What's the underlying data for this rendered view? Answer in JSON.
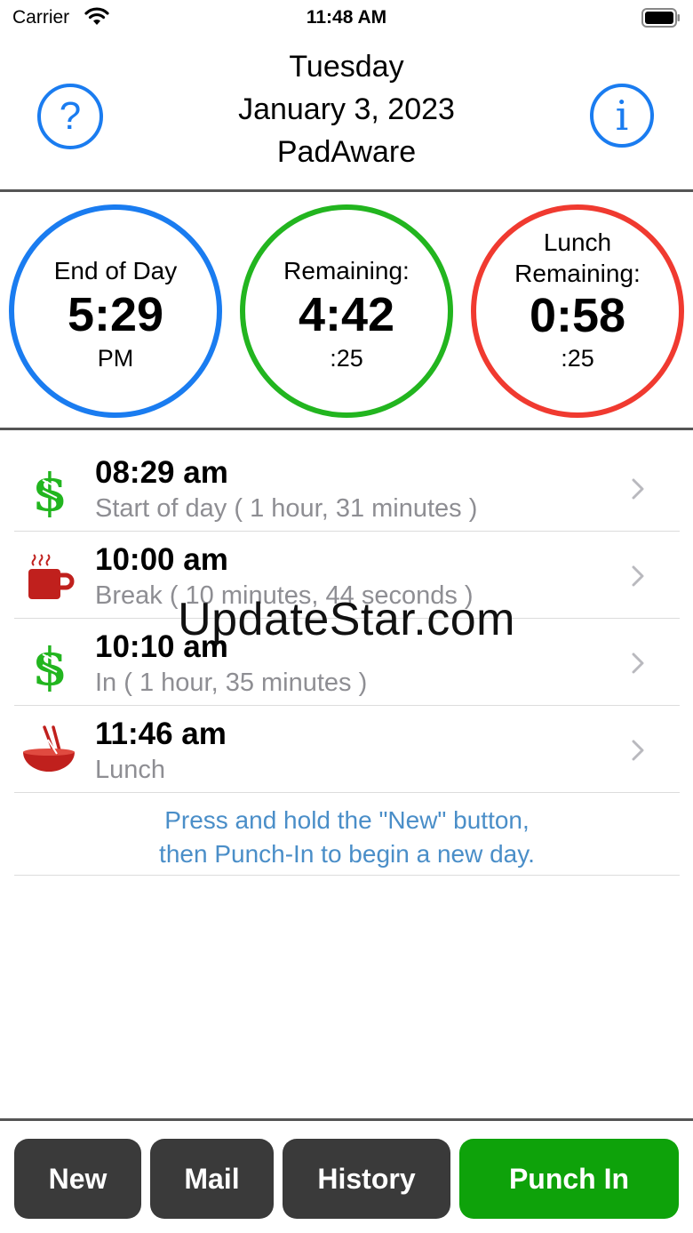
{
  "status_bar": {
    "carrier": "Carrier",
    "time": "11:48 AM"
  },
  "header": {
    "weekday": "Tuesday",
    "date": "January 3, 2023",
    "app_name": "PadAware"
  },
  "gauges": [
    {
      "label": "End of Day",
      "value": "5:29",
      "sub": "PM",
      "color": "#1a7cf0"
    },
    {
      "label": "Remaining:",
      "value": "4:42",
      "sub": ":25",
      "color": "#22b51f"
    },
    {
      "label_line1": "Lunch",
      "label_line2": "Remaining:",
      "value": "0:58",
      "sub": ":25",
      "color": "#f03a30"
    }
  ],
  "entries": [
    {
      "icon": "dollar-icon",
      "time": "08:29 am",
      "description": "Start of day ( 1 hour, 31 minutes )"
    },
    {
      "icon": "coffee-cup-icon",
      "time": "10:00 am",
      "description": "Break ( 10 minutes, 44 seconds )"
    },
    {
      "icon": "dollar-icon",
      "time": "10:10 am",
      "description": "In ( 1 hour, 35 minutes )"
    },
    {
      "icon": "bowl-chopsticks-icon",
      "time": "11:46 am",
      "description": "Lunch"
    }
  ],
  "hint": {
    "line1": "Press and hold the \"New\" button,",
    "line2": "then Punch-In to begin a new day."
  },
  "watermark": "UpdateStar.com",
  "toolbar": {
    "new": "New",
    "mail": "Mail",
    "history": "History",
    "punch_in": "Punch In"
  },
  "colors": {
    "accent_blue": "#1a7cf0",
    "money_green": "#22b51f",
    "lunch_red": "#f03a30",
    "punch_green": "#0ea20a",
    "button_dark": "#3a3a3a"
  }
}
